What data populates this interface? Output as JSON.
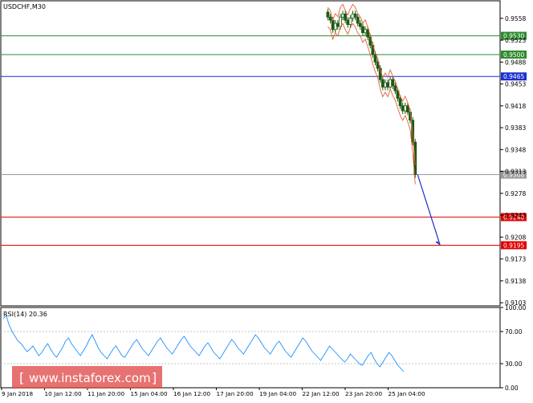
{
  "chart_data": [
    {
      "type": "candlestick",
      "title": "USDCHF,M30",
      "ylim": [
        0.9098,
        0.9586
      ],
      "x_tick_labels": [
        "9 Jan 2018",
        "10 Jan 12:00",
        "11 Jan 20:00",
        "15 Jan 04:00",
        "16 Jan 12:00",
        "17 Jan 20:00",
        "19 Jan 04:00",
        "22 Jan 12:00",
        "23 Jan 20:00",
        "25 Jan 04:00"
      ],
      "y_tick_labels": [
        "0.9558",
        "0.9523",
        "0.9488",
        "0.9453",
        "0.9418",
        "0.9383",
        "0.9348",
        "0.9313",
        "0.9278",
        "0.9243",
        "0.9208",
        "0.9173",
        "0.9138",
        "0.9103"
      ],
      "y_tick_values": [
        0.9558,
        0.9523,
        0.9488,
        0.9453,
        0.9418,
        0.9383,
        0.9348,
        0.9313,
        0.9278,
        0.9243,
        0.9208,
        0.9173,
        0.9138,
        0.9103
      ],
      "levels": [
        {
          "label": "0.9530",
          "value": 0.953,
          "color": "#2e8b2e"
        },
        {
          "label": "0.9500",
          "value": 0.95,
          "color": "#2e8b2e"
        },
        {
          "label": "0.9465",
          "value": 0.9465,
          "color": "#1a2fd0"
        },
        {
          "label": "0.9308",
          "value": 0.9308,
          "color": "#9a9a9a"
        },
        {
          "label": "0.9240",
          "value": 0.924,
          "color": "#e00000"
        },
        {
          "label": "0.9195",
          "value": 0.9195,
          "color": "#e00000"
        }
      ],
      "price_series": [
        {
          "t": 0.655,
          "o": 0.9568,
          "c": 0.956
        },
        {
          "t": 0.66,
          "o": 0.956,
          "c": 0.9555
        },
        {
          "t": 0.665,
          "o": 0.9555,
          "c": 0.954
        },
        {
          "t": 0.67,
          "o": 0.954,
          "c": 0.955
        },
        {
          "t": 0.675,
          "o": 0.955,
          "c": 0.9545
        },
        {
          "t": 0.68,
          "o": 0.9545,
          "c": 0.956
        },
        {
          "t": 0.685,
          "o": 0.956,
          "c": 0.9565
        },
        {
          "t": 0.69,
          "o": 0.9565,
          "c": 0.9555
        },
        {
          "t": 0.695,
          "o": 0.9555,
          "c": 0.9548
        },
        {
          "t": 0.7,
          "o": 0.9548,
          "c": 0.9558
        },
        {
          "t": 0.705,
          "o": 0.9558,
          "c": 0.9565
        },
        {
          "t": 0.71,
          "o": 0.9565,
          "c": 0.956
        },
        {
          "t": 0.715,
          "o": 0.956,
          "c": 0.955
        },
        {
          "t": 0.72,
          "o": 0.955,
          "c": 0.9545
        },
        {
          "t": 0.725,
          "o": 0.9545,
          "c": 0.9535
        },
        {
          "t": 0.73,
          "o": 0.9535,
          "c": 0.954
        },
        {
          "t": 0.735,
          "o": 0.954,
          "c": 0.9528
        },
        {
          "t": 0.74,
          "o": 0.9528,
          "c": 0.9515
        },
        {
          "t": 0.745,
          "o": 0.9515,
          "c": 0.95
        },
        {
          "t": 0.75,
          "o": 0.95,
          "c": 0.9488
        },
        {
          "t": 0.755,
          "o": 0.9488,
          "c": 0.9478
        },
        {
          "t": 0.76,
          "o": 0.9478,
          "c": 0.946
        },
        {
          "t": 0.765,
          "o": 0.946,
          "c": 0.9448
        },
        {
          "t": 0.77,
          "o": 0.9448,
          "c": 0.9455
        },
        {
          "t": 0.775,
          "o": 0.9455,
          "c": 0.9448
        },
        {
          "t": 0.78,
          "o": 0.9448,
          "c": 0.946
        },
        {
          "t": 0.785,
          "o": 0.946,
          "c": 0.945
        },
        {
          "t": 0.79,
          "o": 0.945,
          "c": 0.9442
        },
        {
          "t": 0.795,
          "o": 0.9442,
          "c": 0.943
        },
        {
          "t": 0.8,
          "o": 0.943,
          "c": 0.9418
        },
        {
          "t": 0.805,
          "o": 0.9418,
          "c": 0.941
        },
        {
          "t": 0.81,
          "o": 0.941,
          "c": 0.9418
        },
        {
          "t": 0.815,
          "o": 0.9418,
          "c": 0.9408
        },
        {
          "t": 0.82,
          "o": 0.9408,
          "c": 0.9395
        },
        {
          "t": 0.825,
          "o": 0.9395,
          "c": 0.936
        },
        {
          "t": 0.83,
          "o": 0.936,
          "c": 0.9308
        }
      ],
      "projection": {
        "from": 0.9308,
        "to": 0.9195,
        "color": "#1a2fd0"
      },
      "current_price_label": "0.9308"
    },
    {
      "type": "line",
      "title": "RSI(14) 20.36",
      "ylim": [
        0,
        100
      ],
      "y_tick_labels": [
        "100.00",
        "70.00",
        "30.00",
        "0.00"
      ],
      "y_tick_values": [
        100,
        70,
        30,
        0
      ],
      "reference_lines": [
        70,
        30
      ],
      "series": [
        {
          "color": "#1e90ff",
          "values": [
            86,
            90,
            78,
            70,
            64,
            58,
            55,
            50,
            45,
            48,
            52,
            46,
            40,
            44,
            50,
            55,
            48,
            42,
            38,
            44,
            50,
            58,
            62,
            55,
            50,
            45,
            40,
            46,
            52,
            60,
            66,
            58,
            50,
            44,
            40,
            36,
            42,
            48,
            52,
            46,
            40,
            38,
            44,
            50,
            56,
            60,
            54,
            48,
            44,
            40,
            46,
            52,
            58,
            62,
            56,
            50,
            46,
            42,
            48,
            54,
            60,
            64,
            58,
            52,
            48,
            44,
            40,
            46,
            52,
            56,
            50,
            44,
            40,
            36,
            42,
            48,
            54,
            60,
            56,
            50,
            46,
            42,
            48,
            54,
            60,
            66,
            62,
            56,
            50,
            46,
            42,
            48,
            54,
            58,
            52,
            46,
            42,
            38,
            44,
            50,
            56,
            62,
            58,
            52,
            46,
            42,
            38,
            34,
            40,
            46,
            52,
            48,
            44,
            40,
            36,
            32,
            36,
            42,
            38,
            34,
            30,
            28,
            34,
            40,
            44,
            36,
            30,
            26,
            32,
            38,
            44,
            40,
            34,
            28,
            24,
            20
          ]
        }
      ]
    }
  ],
  "watermark": {
    "text": "www.instaforex.com",
    "bracket_left": "[",
    "bracket_right": "]"
  }
}
